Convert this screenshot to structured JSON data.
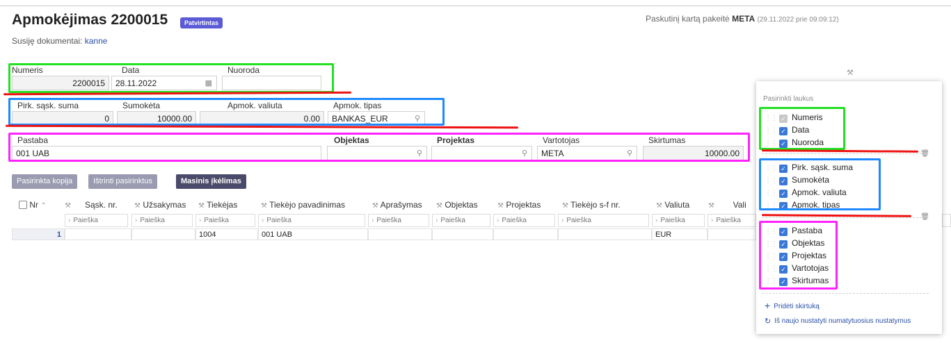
{
  "header": {
    "title": "Apmokėjimas 2200015",
    "status_badge": "Patvirtintas",
    "related_label": "Susiję dokumentai:",
    "related_link": "kanne",
    "last_modified_prefix": "Paskutinį kartą pakeitė",
    "last_modified_user": "META",
    "last_modified_date": "(29.11.2022 prie 09:09:12)"
  },
  "form": {
    "numeris": {
      "label": "Numeris",
      "value": "2200015"
    },
    "data": {
      "label": "Data",
      "value": "28.11.2022"
    },
    "nuoroda": {
      "label": "Nuoroda",
      "value": ""
    },
    "pirk_sask_suma": {
      "label": "Pirk. sąsk. suma",
      "value": "0"
    },
    "sumoketa": {
      "label": "Sumokėta",
      "value": "10000.00"
    },
    "apmok_valiuta": {
      "label": "Apmok. valiuta",
      "value": "0.00"
    },
    "apmok_tipas": {
      "label": "Apmok. tipas",
      "value": "BANKAS_EUR"
    },
    "pastaba": {
      "label": "Pastaba",
      "value": "001 UAB"
    },
    "objektas": {
      "label": "Objektas",
      "value": ""
    },
    "projektas": {
      "label": "Projektas",
      "value": ""
    },
    "vartotojas": {
      "label": "Vartotojas",
      "value": "META"
    },
    "skirtumas": {
      "label": "Skirtumas",
      "value": "10000.00"
    }
  },
  "toolbar": {
    "copy_selected": "Pasirinkta kopija",
    "delete_selected": "Ištrinti pasirinktus",
    "mass_entry": "Masinis įkėlimas"
  },
  "table": {
    "columns": [
      "Nr",
      "Sąsk. nr.",
      "Užsakymas",
      "Tiekėjas",
      "Tiekėjo pavadinimas",
      "Aprašymas",
      "Objektas",
      "Projektas",
      "Tiekėjo s-f nr.",
      "Valiuta",
      "Vali"
    ],
    "filter_placeholder": "Paieška",
    "rows": [
      {
        "nr": "1",
        "sask_nr": "",
        "uzsakymas": "",
        "tiekejas": "1004",
        "pavadinimas": "001 UAB",
        "aprasymas": "",
        "objektas": "",
        "projektas": "",
        "sf_nr": "",
        "valiuta": "EUR"
      }
    ]
  },
  "field_panel": {
    "title": "Pasirinkti laukus",
    "group1": [
      "Numeris",
      "Data",
      "Nuoroda"
    ],
    "group2": [
      "Pirk. sąsk. suma",
      "Sumokėta",
      "Apmok. valiuta",
      "Apmok. tipas"
    ],
    "group3": [
      "Pastaba",
      "Objektas",
      "Projektas",
      "Vartotojas",
      "Skirtumas"
    ],
    "add_tab": "Pridėti skirtuką",
    "reset": "Iš naujo nustatyti numatytuosius nustatymus"
  },
  "colors": {
    "accent": "#5b5bd6",
    "highlight_green": "#22e022",
    "highlight_blue": "#1e88ff",
    "highlight_magenta": "#ff22ff",
    "annotation_red": "#ee1111",
    "checkbox_blue": "#3a78d8"
  }
}
